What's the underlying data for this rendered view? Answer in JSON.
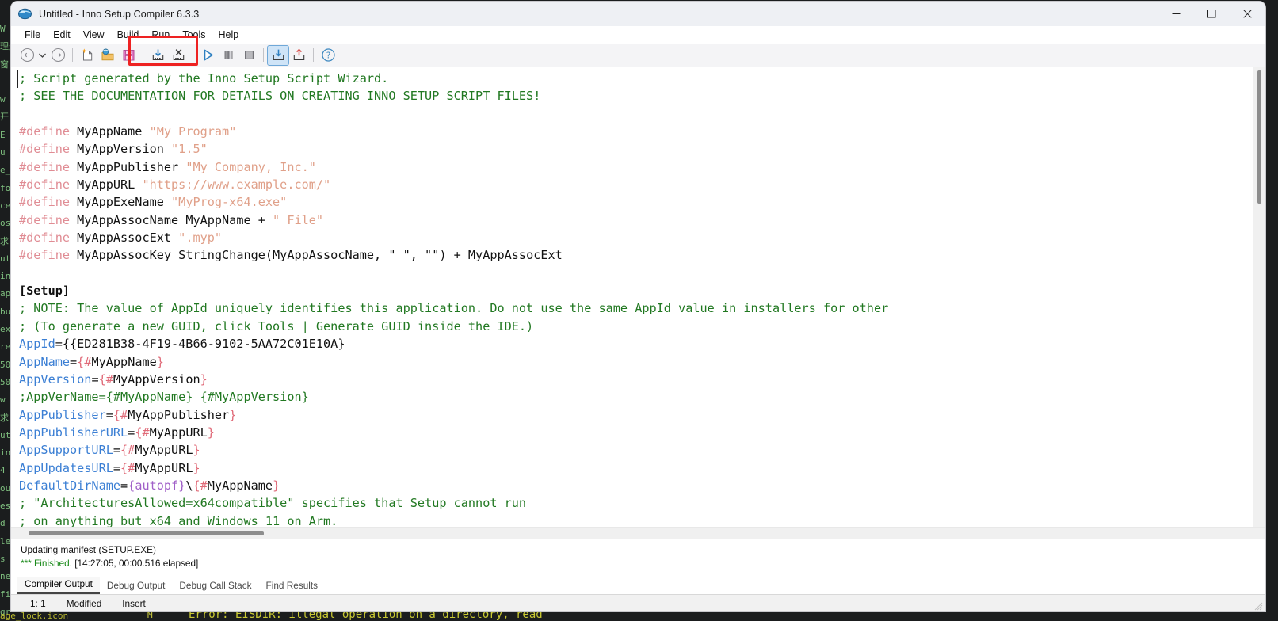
{
  "window": {
    "title": "Untitled - Inno Setup Compiler 6.3.3",
    "app_icon": "inno-setup-globe-icon",
    "controls": {
      "minimize": "—",
      "maximize": "☐",
      "close": "✕"
    }
  },
  "menubar": {
    "items": [
      {
        "label": "File"
      },
      {
        "label": "Edit"
      },
      {
        "label": "View"
      },
      {
        "label": "Build"
      },
      {
        "label": "Run"
      },
      {
        "label": "Tools"
      },
      {
        "label": "Help"
      }
    ]
  },
  "toolbar": {
    "highlight_color": "#ee2222",
    "buttons": [
      {
        "name": "navigate-back-icon",
        "title": "Back"
      },
      {
        "name": "navigate-back-dropdown-icon",
        "title": "Back history"
      },
      {
        "name": "navigate-forward-icon",
        "title": "Forward"
      },
      {
        "name": "new-file-icon",
        "title": "New"
      },
      {
        "name": "open-file-icon",
        "title": "Open"
      },
      {
        "name": "save-file-icon",
        "title": "Save"
      },
      {
        "name": "compile-icon",
        "title": "Compile"
      },
      {
        "name": "stop-compile-icon",
        "title": "Stop Compile"
      },
      {
        "name": "run-icon",
        "title": "Run"
      },
      {
        "name": "pause-icon",
        "title": "Pause"
      },
      {
        "name": "terminate-icon",
        "title": "Terminate"
      },
      {
        "name": "import-icon",
        "title": "Import"
      },
      {
        "name": "export-icon",
        "title": "Export"
      },
      {
        "name": "help-icon",
        "title": "Help"
      }
    ]
  },
  "editor": {
    "lines": [
      [
        {
          "t": "; Script generated by the Inno Setup Script Wizard.",
          "c": "cm"
        }
      ],
      [
        {
          "t": "; SEE THE DOCUMENTATION FOR DETAILS ON CREATING INNO SETUP SCRIPT FILES!",
          "c": "cm"
        }
      ],
      [
        {
          "t": "",
          "c": "pl"
        }
      ],
      [
        {
          "t": "#define",
          "c": "dir"
        },
        {
          "t": " MyAppName ",
          "c": "pl"
        },
        {
          "t": "\"My Program\"",
          "c": "str"
        }
      ],
      [
        {
          "t": "#define",
          "c": "dir"
        },
        {
          "t": " MyAppVersion ",
          "c": "pl"
        },
        {
          "t": "\"1.5\"",
          "c": "str"
        }
      ],
      [
        {
          "t": "#define",
          "c": "dir"
        },
        {
          "t": " MyAppPublisher ",
          "c": "pl"
        },
        {
          "t": "\"My Company, Inc.\"",
          "c": "str"
        }
      ],
      [
        {
          "t": "#define",
          "c": "dir"
        },
        {
          "t": " MyAppURL ",
          "c": "pl"
        },
        {
          "t": "\"https://www.example.com/\"",
          "c": "str"
        }
      ],
      [
        {
          "t": "#define",
          "c": "dir"
        },
        {
          "t": " MyAppExeName ",
          "c": "pl"
        },
        {
          "t": "\"MyProg-x64.exe\"",
          "c": "str"
        }
      ],
      [
        {
          "t": "#define",
          "c": "dir"
        },
        {
          "t": " MyAppAssocName MyAppName + ",
          "c": "pl"
        },
        {
          "t": "\" File\"",
          "c": "str"
        }
      ],
      [
        {
          "t": "#define",
          "c": "dir"
        },
        {
          "t": " MyAppAssocExt ",
          "c": "pl"
        },
        {
          "t": "\".myp\"",
          "c": "str"
        }
      ],
      [
        {
          "t": "#define",
          "c": "dir"
        },
        {
          "t": " MyAppAssocKey StringChange(MyAppAssocName, \" \", \"\") + MyAppAssocExt",
          "c": "pl"
        }
      ],
      [
        {
          "t": "",
          "c": "pl"
        }
      ],
      [
        {
          "t": "[Setup]",
          "c": "sec"
        }
      ],
      [
        {
          "t": "; NOTE: The value of AppId uniquely identifies this application. Do not use the same AppId value in installers for other",
          "c": "cm"
        }
      ],
      [
        {
          "t": "; (To generate a new GUID, click Tools | Generate GUID inside the IDE.)",
          "c": "cm"
        }
      ],
      [
        {
          "t": "AppId",
          "c": "key"
        },
        {
          "t": "={{ED281B38-4F19-4B66-9102-5AA72C01E10A}",
          "c": "pl"
        }
      ],
      [
        {
          "t": "AppName",
          "c": "key"
        },
        {
          "t": "=",
          "c": "pl"
        },
        {
          "t": "{",
          "c": "br"
        },
        {
          "t": "#",
          "c": "br"
        },
        {
          "t": "MyAppName",
          "c": "pl"
        },
        {
          "t": "}",
          "c": "br"
        }
      ],
      [
        {
          "t": "AppVersion",
          "c": "key"
        },
        {
          "t": "=",
          "c": "pl"
        },
        {
          "t": "{#",
          "c": "br"
        },
        {
          "t": "MyAppVersion",
          "c": "pl"
        },
        {
          "t": "}",
          "c": "br"
        }
      ],
      [
        {
          "t": ";AppVerName={#MyAppName} {#MyAppVersion}",
          "c": "cm"
        }
      ],
      [
        {
          "t": "AppPublisher",
          "c": "key"
        },
        {
          "t": "=",
          "c": "pl"
        },
        {
          "t": "{#",
          "c": "br"
        },
        {
          "t": "MyAppPublisher",
          "c": "pl"
        },
        {
          "t": "}",
          "c": "br"
        }
      ],
      [
        {
          "t": "AppPublisherURL",
          "c": "key"
        },
        {
          "t": "=",
          "c": "pl"
        },
        {
          "t": "{#",
          "c": "br"
        },
        {
          "t": "MyAppURL",
          "c": "pl"
        },
        {
          "t": "}",
          "c": "br"
        }
      ],
      [
        {
          "t": "AppSupportURL",
          "c": "key"
        },
        {
          "t": "=",
          "c": "pl"
        },
        {
          "t": "{#",
          "c": "br"
        },
        {
          "t": "MyAppURL",
          "c": "pl"
        },
        {
          "t": "}",
          "c": "br"
        }
      ],
      [
        {
          "t": "AppUpdatesURL",
          "c": "key"
        },
        {
          "t": "=",
          "c": "pl"
        },
        {
          "t": "{#",
          "c": "br"
        },
        {
          "t": "MyAppURL",
          "c": "pl"
        },
        {
          "t": "}",
          "c": "br"
        }
      ],
      [
        {
          "t": "DefaultDirName",
          "c": "key"
        },
        {
          "t": "=",
          "c": "pl"
        },
        {
          "t": "{autopf}",
          "c": "pth"
        },
        {
          "t": "\\",
          "c": "pl"
        },
        {
          "t": "{#",
          "c": "br"
        },
        {
          "t": "MyAppName",
          "c": "pl"
        },
        {
          "t": "}",
          "c": "br"
        }
      ],
      [
        {
          "t": "; \"ArchitecturesAllowed=x64compatible\" specifies that Setup cannot run",
          "c": "cm"
        }
      ],
      [
        {
          "t": "; on anything but x64 and Windows 11 on Arm.",
          "c": "cm"
        }
      ]
    ]
  },
  "output": {
    "status_line": "Updating manifest (SETUP.EXE)",
    "finished_marker": "*** Finished.",
    "finished_detail": "[14:27:05, 00:00.516 elapsed]"
  },
  "output_tabs": {
    "items": [
      {
        "label": "Compiler Output",
        "selected": true
      },
      {
        "label": "Debug Output",
        "selected": false
      },
      {
        "label": "Debug Call Stack",
        "selected": false
      },
      {
        "label": "Find Results",
        "selected": false
      }
    ]
  },
  "statusbar": {
    "position": "1:  1",
    "modified": "Modified",
    "insert_mode": "Insert"
  },
  "background_terminal": {
    "left_column_text": "W\n理题\n窗\n\nw\n开\nE\nu\ne_\nfo\nce\nos\n求\nut\nin\nap\nbu\nex\nre\n50\n50\nw\n求\nut\nin\n4\nou\nes\nd\nle\ns\nne\nfi\ngr\nto\n",
    "bottom_left_label": "age_lock.icon",
    "bottom_mid_label": "M",
    "bottom_error_text": "Error: EISDIR: illegal operation on a directory, read"
  }
}
